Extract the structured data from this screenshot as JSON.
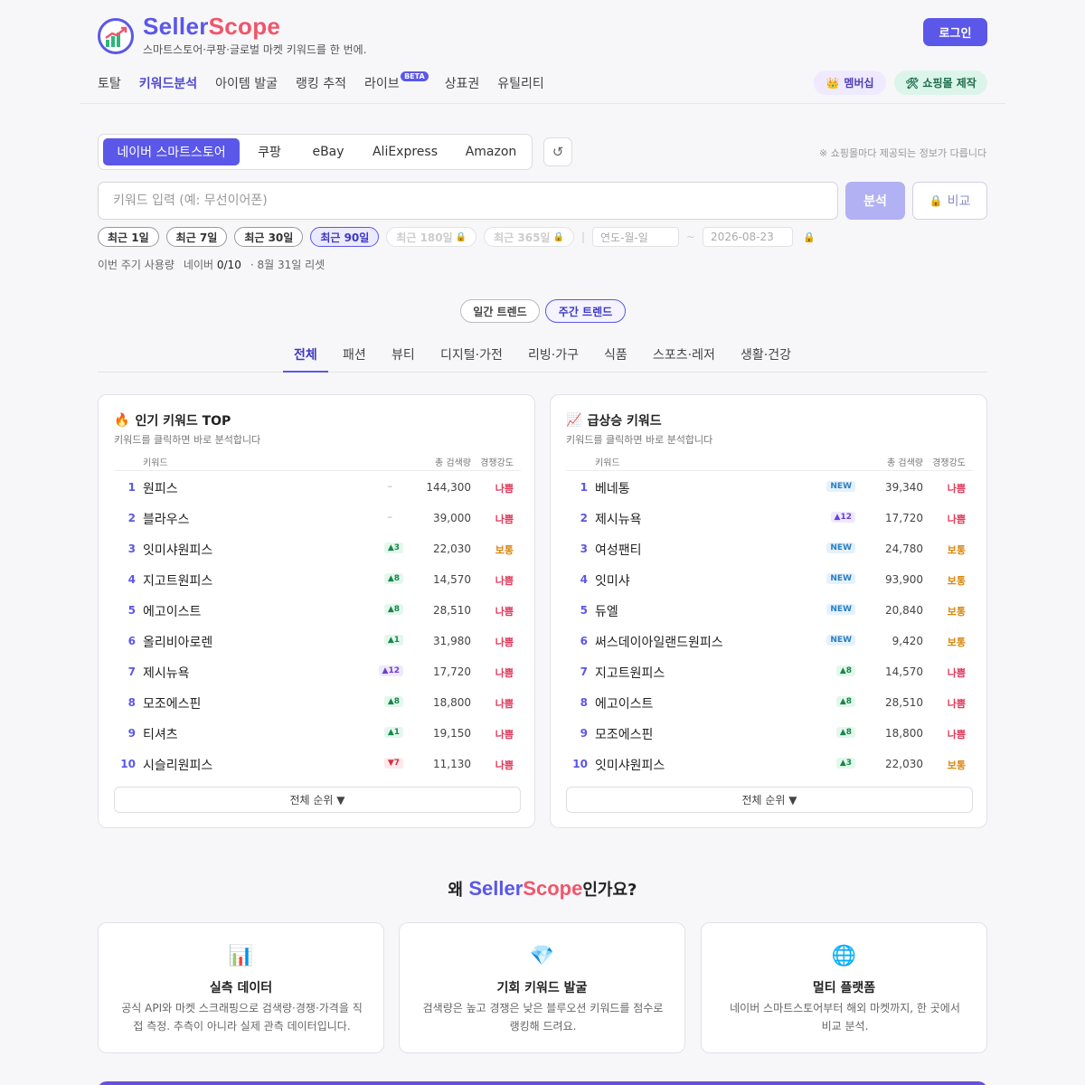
{
  "brand": {
    "name_a": "Seller",
    "name_b": "Scope",
    "tagline": "스마트스토어·쿠팡·글로벌 마켓 키워드를 한 번에."
  },
  "header": {
    "login": "로그인",
    "membership": "멤버십",
    "shop_build": "쇼핑몰 제작"
  },
  "nav": [
    "토탈",
    "키워드분석",
    "아이템 발굴",
    "랭킹 추적",
    "라이브",
    "상표권",
    "유틸리티"
  ],
  "nav_active": "키워드분석",
  "nav_beta": "BETA",
  "platforms": [
    "네이버 스마트스토어",
    "쿠팡",
    "eBay",
    "AliExpress",
    "Amazon"
  ],
  "platform_note": "※ 쇼핑몰마다 제공되는 정보가 다릅니다",
  "search": {
    "placeholder": "키워드 입력 (예: 무선이어폰)",
    "analyze": "분석",
    "compare": "비교"
  },
  "periods": {
    "p1": "최근 1일",
    "p7": "최근 7일",
    "p30": "최근 30일",
    "p90": "최근 90일",
    "p180": "최근 180일",
    "p365": "최근 365일",
    "date_from_placeholder": "연도-월-일",
    "date_to": "2026-08-23",
    "tilde": "~",
    "pipe": "|"
  },
  "usage": {
    "label": "이번 주기 사용량",
    "naver": "네이버",
    "count": "0/10",
    "reset": "· 8월 31일 리셋"
  },
  "trend": {
    "daily": "일간 트렌드",
    "weekly": "주간 트렌드"
  },
  "categories": [
    "전체",
    "패션",
    "뷰티",
    "디지털·가전",
    "리빙·가구",
    "식품",
    "스포츠·레저",
    "생활·건강"
  ],
  "table_head": {
    "keyword": "키워드",
    "volume": "총 검색량",
    "competition": "경쟁강도"
  },
  "popular": {
    "title": "인기 키워드 TOP",
    "sub": "키워드를 클릭하면 바로 분석합니다",
    "more": "전체 순위 ▼",
    "rows": [
      {
        "rank": "1",
        "kw": "원피스",
        "badge": "–",
        "type": "dash",
        "vol": "144,300",
        "comp": "나쁨",
        "level": "bad"
      },
      {
        "rank": "2",
        "kw": "블라우스",
        "badge": "–",
        "type": "dash",
        "vol": "39,000",
        "comp": "나쁨",
        "level": "bad"
      },
      {
        "rank": "3",
        "kw": "잇미샤원피스",
        "badge": "▲3",
        "type": "up",
        "vol": "22,030",
        "comp": "보통",
        "level": "mid"
      },
      {
        "rank": "4",
        "kw": "지고트원피스",
        "badge": "▲8",
        "type": "up",
        "vol": "14,570",
        "comp": "나쁨",
        "level": "bad"
      },
      {
        "rank": "5",
        "kw": "에고이스트",
        "badge": "▲8",
        "type": "up",
        "vol": "28,510",
        "comp": "나쁨",
        "level": "bad"
      },
      {
        "rank": "6",
        "kw": "올리비아로렌",
        "badge": "▲1",
        "type": "up",
        "vol": "31,980",
        "comp": "나쁨",
        "level": "bad"
      },
      {
        "rank": "7",
        "kw": "제시뉴욕",
        "badge": "▲12",
        "type": "upbig",
        "vol": "17,720",
        "comp": "나쁨",
        "level": "bad"
      },
      {
        "rank": "8",
        "kw": "모조에스핀",
        "badge": "▲8",
        "type": "up",
        "vol": "18,800",
        "comp": "나쁨",
        "level": "bad"
      },
      {
        "rank": "9",
        "kw": "티셔츠",
        "badge": "▲1",
        "type": "up",
        "vol": "19,150",
        "comp": "나쁨",
        "level": "bad"
      },
      {
        "rank": "10",
        "kw": "시슬리원피스",
        "badge": "▼7",
        "type": "down",
        "vol": "11,130",
        "comp": "나쁨",
        "level": "bad"
      }
    ]
  },
  "rising": {
    "title": "급상승 키워드",
    "sub": "키워드를 클릭하면 바로 분석합니다",
    "more": "전체 순위 ▼",
    "rows": [
      {
        "rank": "1",
        "kw": "베네통",
        "badge": "NEW",
        "type": "new",
        "vol": "39,340",
        "comp": "나쁨",
        "level": "bad"
      },
      {
        "rank": "2",
        "kw": "제시뉴욕",
        "badge": "▲12",
        "type": "upbig",
        "vol": "17,720",
        "comp": "나쁨",
        "level": "bad"
      },
      {
        "rank": "3",
        "kw": "여성팬티",
        "badge": "NEW",
        "type": "new",
        "vol": "24,780",
        "comp": "보통",
        "level": "mid"
      },
      {
        "rank": "4",
        "kw": "잇미샤",
        "badge": "NEW",
        "type": "new",
        "vol": "93,900",
        "comp": "보통",
        "level": "mid"
      },
      {
        "rank": "5",
        "kw": "듀엘",
        "badge": "NEW",
        "type": "new",
        "vol": "20,840",
        "comp": "보통",
        "level": "mid"
      },
      {
        "rank": "6",
        "kw": "써스데이아일랜드원피스",
        "badge": "NEW",
        "type": "new",
        "vol": "9,420",
        "comp": "보통",
        "level": "mid"
      },
      {
        "rank": "7",
        "kw": "지고트원피스",
        "badge": "▲8",
        "type": "up",
        "vol": "14,570",
        "comp": "나쁨",
        "level": "bad"
      },
      {
        "rank": "8",
        "kw": "에고이스트",
        "badge": "▲8",
        "type": "up",
        "vol": "28,510",
        "comp": "나쁨",
        "level": "bad"
      },
      {
        "rank": "9",
        "kw": "모조에스핀",
        "badge": "▲8",
        "type": "up",
        "vol": "18,800",
        "comp": "나쁨",
        "level": "bad"
      },
      {
        "rank": "10",
        "kw": "잇미샤원피스",
        "badge": "▲3",
        "type": "up",
        "vol": "22,030",
        "comp": "보통",
        "level": "mid"
      }
    ]
  },
  "why": {
    "prefix": "왜 ",
    "brand_a": "Seller",
    "brand_b": "Scope",
    "suffix": "인가요?",
    "cards": [
      {
        "icon": "chart-icon",
        "title": "실측 데이터",
        "desc": "공식 API와 마켓 스크래핑으로 검색량·경쟁·가격을 직접 측정. 추측이 아니라 실제 관측 데이터입니다."
      },
      {
        "icon": "diamond-icon",
        "title": "기회 키워드 발굴",
        "desc": "검색량은 높고 경쟁은 낮은 블루오션 키워드를 점수로 랭킹해 드려요."
      },
      {
        "icon": "globe-icon",
        "title": "멀티 플랫폼",
        "desc": "네이버 스마트스토어부터 해외 마켓까지, 한 곳에서 비교 분석."
      }
    ]
  },
  "colors": {
    "accent": "#5b57e8",
    "brand_red": "#f0566b",
    "bad": "#e0385a",
    "mid": "#d9870f"
  }
}
